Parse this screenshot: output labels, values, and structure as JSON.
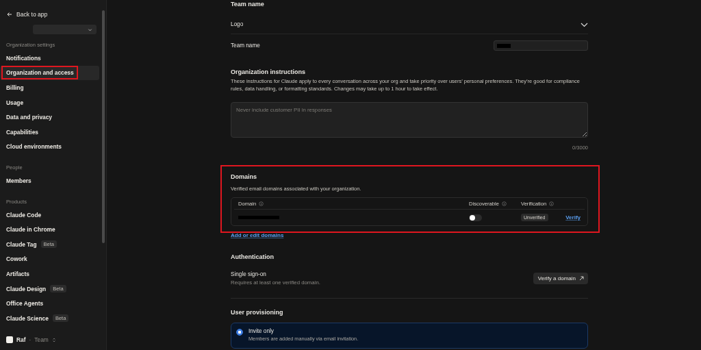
{
  "sidebar": {
    "back_link": "Back to app",
    "sections": [
      {
        "label": "Organization settings",
        "items": [
          {
            "label": "Notifications",
            "selected": false,
            "highlighted": false
          },
          {
            "label": "Organization and access",
            "selected": true,
            "highlighted": true
          },
          {
            "label": "Billing",
            "selected": false,
            "highlighted": false
          },
          {
            "label": "Usage",
            "selected": false,
            "highlighted": false
          },
          {
            "label": "Data and privacy",
            "selected": false,
            "highlighted": false
          },
          {
            "label": "Capabilities",
            "selected": false,
            "highlighted": false
          },
          {
            "label": "Cloud environments",
            "selected": false,
            "highlighted": false
          }
        ]
      },
      {
        "label": "People",
        "items": [
          {
            "label": "Members",
            "selected": false,
            "highlighted": false
          }
        ]
      },
      {
        "label": "Products",
        "items": [
          {
            "label": "Claude Code",
            "selected": false,
            "highlighted": false
          },
          {
            "label": "Claude in Chrome",
            "selected": false,
            "highlighted": false
          },
          {
            "label": "Claude Tag",
            "badge": "Beta",
            "selected": false,
            "highlighted": false
          },
          {
            "label": "Cowork",
            "selected": false,
            "highlighted": false
          },
          {
            "label": "Artifacts",
            "selected": false,
            "highlighted": false
          },
          {
            "label": "Claude Design",
            "badge": "Beta",
            "selected": false,
            "highlighted": false
          },
          {
            "label": "Office Agents",
            "selected": false,
            "highlighted": false
          },
          {
            "label": "Claude Science",
            "badge": "Beta",
            "selected": false,
            "highlighted": false
          }
        ]
      }
    ],
    "account": {
      "name": "Raf",
      "separator": "·",
      "plan": "Team"
    }
  },
  "main": {
    "team_heading": "Team name",
    "logo_row": {
      "label": "Logo",
      "expanded": false
    },
    "team_name": {
      "label": "Team name"
    },
    "instructions": {
      "title": "Organization instructions",
      "description": "These instructions for Claude apply to every conversation across your org and take priority over users’ personal preferences. They’re good for compliance rules, data handling, or formatting standards. Changes may take up to 1 hour to take effect.",
      "placeholder": "Never include customer PII in responses",
      "counter": "0/3000"
    },
    "domains": {
      "title": "Domains",
      "description": "Verified email domains associated with your organization.",
      "highlighted": true,
      "columns": [
        {
          "label": "Domain"
        },
        {
          "label": "Discoverable"
        },
        {
          "label": "Verification"
        }
      ],
      "rows": [
        {
          "discoverable": false,
          "status": "Unverified",
          "action": "Verify"
        }
      ],
      "add_link": "Add or edit domains"
    },
    "authentication": {
      "title": "Authentication",
      "sso": {
        "title": "Single sign-on",
        "description": "Requires at least one verified domain.",
        "button": "Verify a domain"
      }
    },
    "user_provisioning": {
      "title": "User provisioning",
      "options": [
        {
          "label": "Invite only",
          "description": "Members are added manually via email invitation.",
          "selected": true
        }
      ]
    }
  }
}
